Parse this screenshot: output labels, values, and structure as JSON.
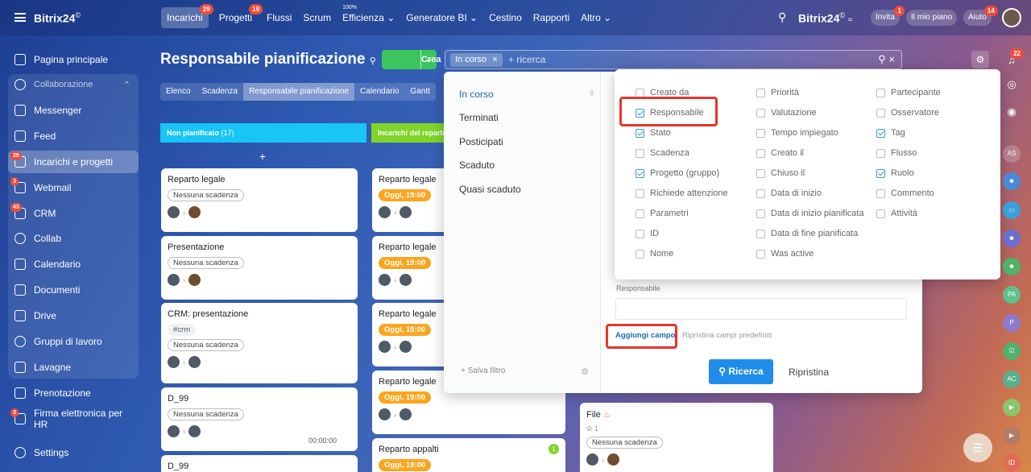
{
  "topbar": {
    "logo": "Bitrix24",
    "nav": [
      {
        "label": "Incarichi",
        "badge": "29",
        "active": true
      },
      {
        "label": "Progetti",
        "badge": "19"
      },
      {
        "label": "Flussi"
      },
      {
        "label": "Scrum"
      },
      {
        "label": "Efficienza",
        "pct": "100%"
      },
      {
        "label": "Generatore BI"
      },
      {
        "label": "Cestino"
      },
      {
        "label": "Rapporti"
      },
      {
        "label": "Altro"
      }
    ],
    "logo_right": "Bitrix24",
    "invita": "Invita",
    "invita_badge": "1",
    "mio_piano": "Il mio piano",
    "aiuto": "Aiuto",
    "aiuto_badge": "14"
  },
  "sidebar": {
    "items": [
      {
        "label": "Pagina principale"
      },
      {
        "label": "Collaborazione"
      },
      {
        "label": "Messenger"
      },
      {
        "label": "Feed"
      },
      {
        "label": "Incarichi e progetti",
        "badge": "29"
      },
      {
        "label": "Webmail",
        "badge": "3"
      },
      {
        "label": "CRM",
        "badge": "43"
      },
      {
        "label": "Collab"
      },
      {
        "label": "Calendario"
      },
      {
        "label": "Documenti"
      },
      {
        "label": "Drive"
      },
      {
        "label": "Gruppi di lavoro"
      },
      {
        "label": "Lavagne"
      },
      {
        "label": "Prenotazione"
      },
      {
        "label": "Firma elettronica per HR",
        "badge": "3"
      },
      {
        "label": "Settings"
      }
    ]
  },
  "page": {
    "title": "Responsabile pianificazione",
    "crea": "Crea",
    "search_chip": "In corso",
    "search_placeholder": "+ ricerca",
    "views": [
      "Elenco",
      "Scadenza",
      "Responsabile pianificazione",
      "Calendario",
      "Gantt"
    ]
  },
  "columns": {
    "col1": {
      "title": "Non pianificato",
      "count": "(17)",
      "color": "#18c5f4"
    },
    "col2": {
      "title": "Incarichi del reparto",
      "color": "#7fd52a"
    }
  },
  "cards_col1": [
    {
      "title": "Reparto legale",
      "tag": "Nessuna scadenza"
    },
    {
      "title": "Presentazione",
      "tag": "Nessuna scadenza"
    },
    {
      "title": "CRM: presentazione",
      "hashtag": "#crm",
      "tag": "Nessuna scadenza"
    },
    {
      "title": "D_99",
      "tag": "Nessuna scadenza",
      "time": "00:00:00"
    },
    {
      "title": "D_99"
    }
  ],
  "cards_col2": [
    {
      "title": "Reparto legale",
      "tag": "Oggi, 19:00"
    },
    {
      "title": "Reparto legale",
      "tag": "Oggi, 19:00"
    },
    {
      "title": "Reparto legale",
      "tag": "Oggi, 19:00"
    },
    {
      "title": "Reparto legale",
      "tag": "Oggi, 19:00"
    },
    {
      "title": "Reparto appalti",
      "tag": "Oggi, 19:00",
      "badge": "1"
    }
  ],
  "card_col3": {
    "title": "File",
    "count": "1",
    "tag": "Nessuna scadenza"
  },
  "filter_panel": {
    "presets": [
      "In corso",
      "Terminati",
      "Posticipati",
      "Scaduto",
      "Quasi scaduto"
    ],
    "salva": "+ Salva filtro",
    "resp_label": "Responsabile",
    "aggiungi": "Aggiungi campo",
    "ripristina_campi": "Ripristina campi predefiniti",
    "ricerca": "Ricerca",
    "ripristina": "Ripristina"
  },
  "field_options": {
    "col1": [
      {
        "label": "Creato da",
        "checked": false
      },
      {
        "label": "Responsabile",
        "checked": true
      },
      {
        "label": "Stato",
        "checked": true
      },
      {
        "label": "Scadenza",
        "checked": false
      },
      {
        "label": "Progetto (gruppo)",
        "checked": true
      },
      {
        "label": "Richiede attenzione",
        "checked": false
      },
      {
        "label": "Parametri",
        "checked": false
      },
      {
        "label": "ID",
        "checked": false
      },
      {
        "label": "Nome",
        "checked": false
      }
    ],
    "col2": [
      {
        "label": "Priorità",
        "checked": false
      },
      {
        "label": "Valutazione",
        "checked": false
      },
      {
        "label": "Tempo impiegato",
        "checked": false
      },
      {
        "label": "Creato il",
        "checked": false
      },
      {
        "label": "Chiuso il",
        "checked": false
      },
      {
        "label": "Data di inizio",
        "checked": false
      },
      {
        "label": "Data di inizio pianificata",
        "checked": false
      },
      {
        "label": "Data di fine pianificata",
        "checked": false
      },
      {
        "label": "Was active",
        "checked": false
      }
    ],
    "col3": [
      {
        "label": "Partecipante",
        "checked": false
      },
      {
        "label": "Osservatore",
        "checked": false
      },
      {
        "label": "Tag",
        "checked": true
      },
      {
        "label": "Flusso",
        "checked": false
      },
      {
        "label": "Ruolo",
        "checked": true
      },
      {
        "label": "Commento",
        "checked": false
      },
      {
        "label": "Attività",
        "checked": false
      }
    ]
  },
  "right_bar": {
    "notif_badge": "22",
    "avatars": [
      "AS",
      "PA",
      "P",
      "AC",
      "ID"
    ]
  }
}
